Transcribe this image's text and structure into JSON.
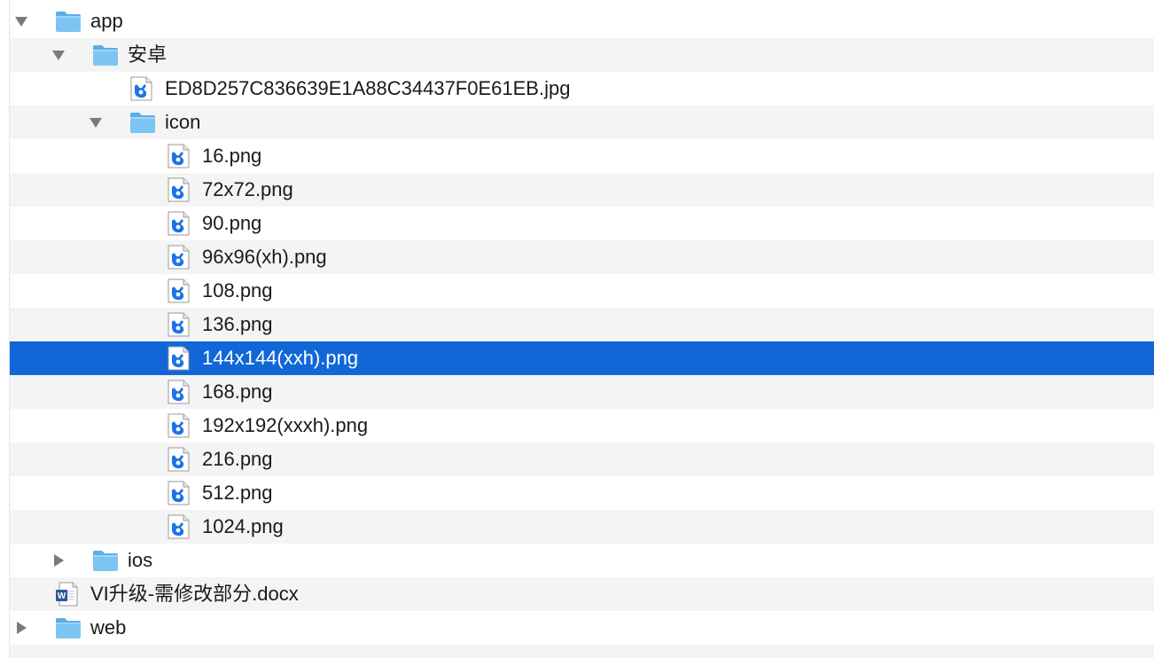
{
  "rows": [
    {
      "label": "app",
      "kind": "folder",
      "disclosure": "expanded",
      "level": 0
    },
    {
      "label": "安卓",
      "kind": "folder",
      "disclosure": "expanded",
      "level": 1
    },
    {
      "label": "ED8D257C836639E1A88C34437F0E61EB.jpg",
      "kind": "image",
      "disclosure": "none",
      "level": 2
    },
    {
      "label": "icon",
      "kind": "folder",
      "disclosure": "expanded",
      "level": 2
    },
    {
      "label": "16.png",
      "kind": "image",
      "disclosure": "none",
      "level": 3
    },
    {
      "label": "72x72.png",
      "kind": "image",
      "disclosure": "none",
      "level": 3
    },
    {
      "label": "90.png",
      "kind": "image",
      "disclosure": "none",
      "level": 3
    },
    {
      "label": "96x96(xh).png",
      "kind": "image",
      "disclosure": "none",
      "level": 3
    },
    {
      "label": "108.png",
      "kind": "image",
      "disclosure": "none",
      "level": 3
    },
    {
      "label": "136.png",
      "kind": "image",
      "disclosure": "none",
      "level": 3
    },
    {
      "label": "144x144(xxh).png",
      "kind": "image",
      "disclosure": "none",
      "level": 3,
      "selected": true
    },
    {
      "label": "168.png",
      "kind": "image",
      "disclosure": "none",
      "level": 3
    },
    {
      "label": "192x192(xxxh).png",
      "kind": "image",
      "disclosure": "none",
      "level": 3
    },
    {
      "label": "216.png",
      "kind": "image",
      "disclosure": "none",
      "level": 3
    },
    {
      "label": "512.png",
      "kind": "image",
      "disclosure": "none",
      "level": 3
    },
    {
      "label": "1024.png",
      "kind": "image",
      "disclosure": "none",
      "level": 3
    },
    {
      "label": "ios",
      "kind": "folder",
      "disclosure": "collapsed",
      "level": 1
    },
    {
      "label": "VI升级-需修改部分.docx",
      "kind": "word",
      "disclosure": "none",
      "level": 0
    },
    {
      "label": "web",
      "kind": "folder",
      "disclosure": "collapsed",
      "level": 0
    },
    {
      "label": "",
      "kind": "empty",
      "disclosure": "none",
      "level": 0
    }
  ],
  "colors": {
    "selection": "#1167d8",
    "stripe": "#f4f4f5",
    "folder": "#7cc4f2",
    "image_blue": "#1a73e8"
  }
}
